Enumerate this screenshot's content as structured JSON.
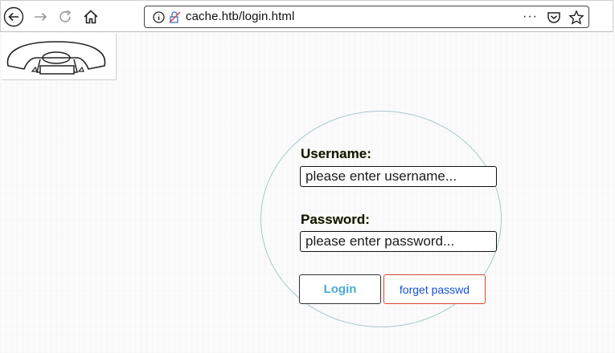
{
  "browser": {
    "url": "cache.htb/login.html",
    "page_actions": "···",
    "icons": [
      "back-icon",
      "forward-icon",
      "reload-icon",
      "home-icon",
      "info-icon",
      "permissions-icon",
      "pocket-icon",
      "bookmark-star-icon"
    ]
  },
  "logo": {
    "icon": "rotary-telephone-logo"
  },
  "login": {
    "username_label": "Username:",
    "username_placeholder": "please enter username...",
    "username_value": "",
    "password_label": "Password:",
    "password_placeholder": "please enter password...",
    "password_value": "",
    "login_button": "Login",
    "forget_button": "forget passwd"
  },
  "colors": {
    "login_text": "#4aa9d6",
    "forget_text": "#1650d8",
    "forget_border": "#d44a2a",
    "label_glow": "#c7d84a"
  }
}
